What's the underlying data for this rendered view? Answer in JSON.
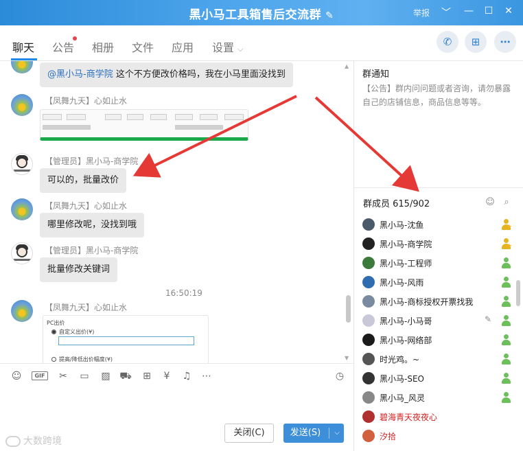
{
  "window": {
    "title": "黑小马工具箱售后交流群",
    "report_label": "举报",
    "icons": [
      "pencil-icon",
      "chevron-down-icon",
      "minimize-icon",
      "maximize-icon",
      "close-icon"
    ]
  },
  "tabs": [
    {
      "label": "聊天",
      "active": true
    },
    {
      "label": "公告",
      "has_dot": true
    },
    {
      "label": "相册"
    },
    {
      "label": "文件"
    },
    {
      "label": "应用"
    },
    {
      "label": "设置",
      "has_chevron": true
    }
  ],
  "header_actions": [
    "phone-icon",
    "add-chat-icon",
    "more-icon"
  ],
  "chat": {
    "messages": [
      {
        "type": "text",
        "avatar": "sunflower",
        "mention": "@黑小马-商学院",
        "text": " 这个不方便改价格吗，我在小马里面没找到"
      },
      {
        "type": "image",
        "avatar": "sunflower",
        "sender": "【凤舞九天】心如止水"
      },
      {
        "type": "text",
        "avatar": "cartoon",
        "sender": "【管理员】黑小马-商学院",
        "text": "可以的，批量改价"
      },
      {
        "type": "text",
        "avatar": "sunflower",
        "sender": "【凤舞九天】心如止水",
        "text": "哪里修改呢，没找到哦"
      },
      {
        "type": "text",
        "avatar": "cartoon",
        "sender": "【管理员】黑小马-商学院",
        "text": "批量修改关键词"
      },
      {
        "type": "timestamp",
        "text": "16:50:19"
      },
      {
        "type": "image",
        "avatar": "sunflower",
        "sender": "【凤舞九天】心如止水",
        "image_text": {
          "title": "PC出价",
          "option1": "自定义出价(¥)",
          "option2": "提高/降低出价幅度(¥)"
        }
      }
    ]
  },
  "toolbar": {
    "icons": [
      "emoji-icon",
      "gif-icon",
      "scissors-icon",
      "folder-icon",
      "image-icon",
      "red-packet-icon",
      "gift-icon",
      "coupon-icon",
      "bell-icon",
      "more-dots-icon"
    ],
    "gif_label": "GIF",
    "history_icon": "clock-icon"
  },
  "compose": {
    "close_label": "关闭(C)",
    "send_label": "发送(S)"
  },
  "watermark": {
    "text": "大数跨境"
  },
  "notice": {
    "title": "群通知",
    "text": "【公告】群内问问题或者咨询，请勿暴露自己的店铺信息，商品信息等等。"
  },
  "members": {
    "header": "群成员 615/902",
    "list": [
      {
        "name": "黑小马-沈鱼",
        "role": "owner",
        "avatar_color": "#4a5a6a"
      },
      {
        "name": "黑小马-商学院",
        "role": "owner",
        "avatar_color": "#222222"
      },
      {
        "name": "黑小马-工程师",
        "role": "admin",
        "avatar_color": "#3b7a3b"
      },
      {
        "name": "黑小马-风雨",
        "role": "admin",
        "avatar_color": "#2f6db0"
      },
      {
        "name": "黑小马-商标授权开票找我",
        "role": "admin",
        "avatar_color": "#7a8aa0"
      },
      {
        "name": "黑小马-小马哥",
        "role": "admin",
        "avatar_color": "#c8c8d8",
        "editable": true
      },
      {
        "name": "黑小马-网络部",
        "role": "admin",
        "avatar_color": "#1b1b1b"
      },
      {
        "name": "时光鸡。~",
        "role": "admin",
        "avatar_color": "#555555"
      },
      {
        "name": "黑小马-SEO",
        "role": "admin",
        "avatar_color": "#333333"
      },
      {
        "name": "黑小马_风灵",
        "role": "admin",
        "avatar_color": "#888888"
      },
      {
        "name": "碧海青天夜夜心",
        "role": "member",
        "avatar_color": "#b03030",
        "highlight": true
      },
      {
        "name": "汐拾",
        "role": "member",
        "avatar_color": "#d06040",
        "highlight": true
      }
    ]
  },
  "colors": {
    "accent": "#1e8ae6",
    "title_bar": "#4fa6ec",
    "arrow": "#e53935",
    "highlight_name": "#d42020"
  }
}
